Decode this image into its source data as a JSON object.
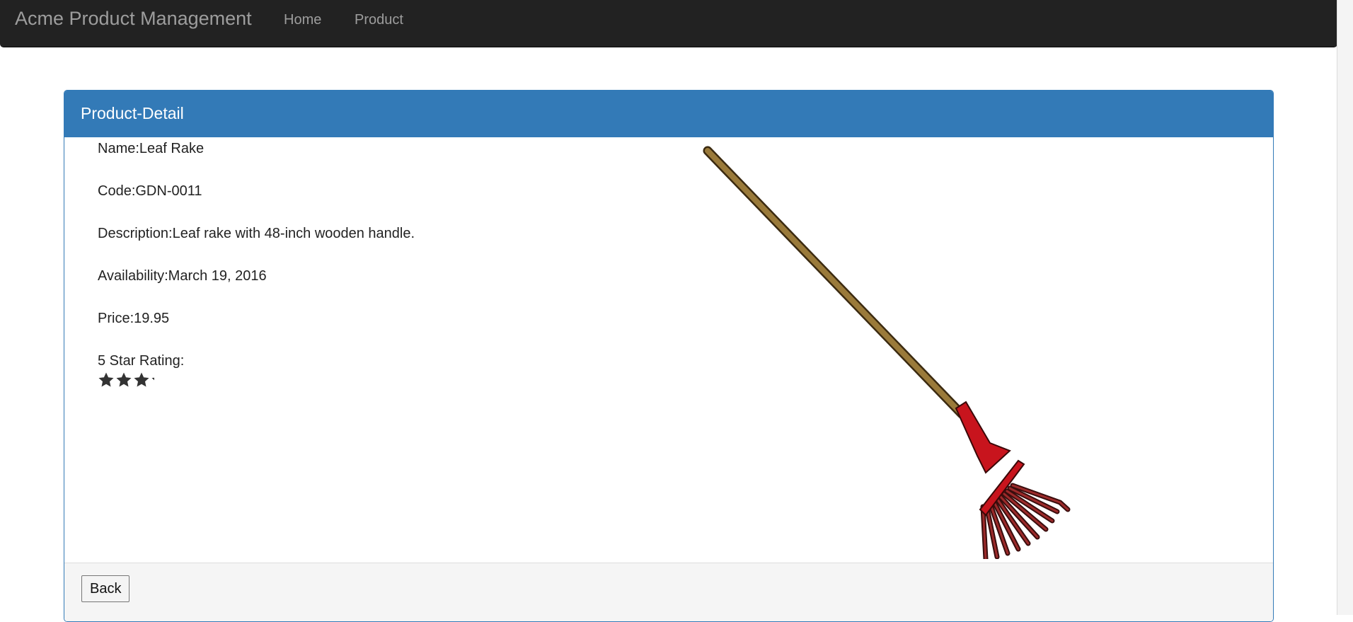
{
  "navbar": {
    "brand": "Acme Product Management",
    "links": [
      {
        "label": "Home"
      },
      {
        "label": "Product"
      }
    ]
  },
  "panel": {
    "title": "Product-Detail",
    "name": "Name:Leaf Rake",
    "code": "Code:GDN-0011",
    "description": "Description:Leaf rake with 48-inch wooden handle.",
    "availability": "Availability:March 19, 2016",
    "price": "Price:19.95",
    "rating_label": "5 Star Rating:",
    "rating": 3.2,
    "rating_max": 5,
    "image_icon": "leaf-rake-icon",
    "back_label": "Back"
  },
  "colors": {
    "navbar": "#222222",
    "nav_text": "#9d9d9d",
    "panel_primary": "#337ab7",
    "star": "#333333",
    "rake_head": "#c8141d",
    "rake_handle": "#9a7a3a"
  }
}
